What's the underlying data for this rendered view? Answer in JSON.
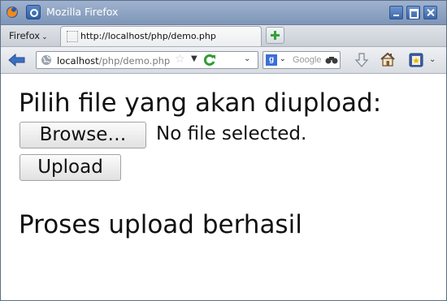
{
  "window": {
    "title": "Mozilla Firefox"
  },
  "tabstrip": {
    "menu_label": "Firefox",
    "tabs": [
      {
        "label": "http://localhost/php/demo.php"
      }
    ]
  },
  "navbar": {
    "url_host": "localhost",
    "url_path": "/php/demo.php",
    "search_placeholder": "Google"
  },
  "page": {
    "heading": "Pilih file yang akan diupload:",
    "browse_label": "Browse…",
    "file_status": "No file selected.",
    "upload_label": "Upload",
    "result": "Proses upload berhasil"
  },
  "icons": {
    "firefox": "firefox-icon",
    "system_menu": "system-menu-icon",
    "favicon": "page-favicon-icon",
    "new_tab": "plus-icon",
    "back": "back-arrow-icon",
    "globe": "globe-icon",
    "star": "star-icon",
    "reload": "reload-icon",
    "search_engine": "google-icon",
    "search_go": "binoculars-icon",
    "downloads": "download-arrow-icon",
    "home": "home-icon",
    "bookmarks": "bookmarks-icon"
  },
  "colors": {
    "titlebar": "#8fa5c4",
    "new_tab_plus": "#36a136",
    "reload_green": "#2f9e2f"
  }
}
